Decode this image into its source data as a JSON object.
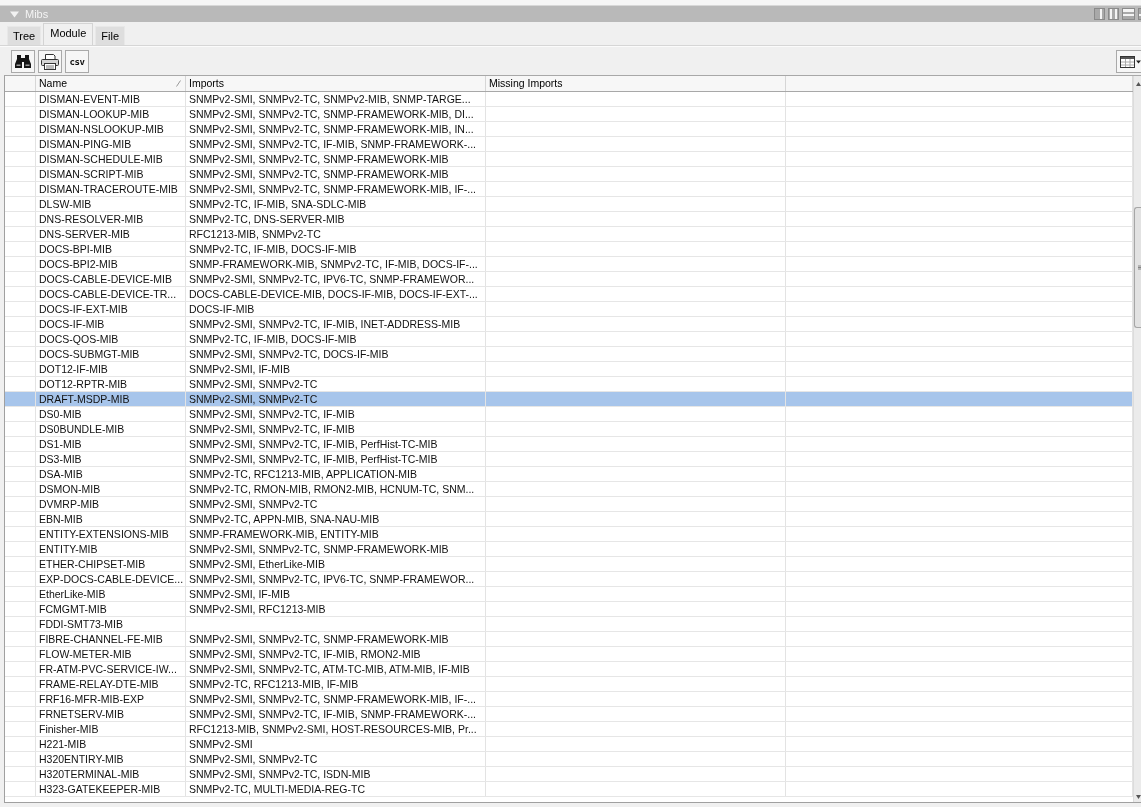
{
  "panel": {
    "title": "Mibs",
    "expanded": true
  },
  "tabs": [
    {
      "label": "Tree",
      "selected": false
    },
    {
      "label": "Module",
      "selected": true
    },
    {
      "label": "File",
      "selected": false
    }
  ],
  "toolbar": [
    {
      "kind": "find"
    },
    {
      "kind": "print"
    },
    {
      "kind": "csv",
      "label": "csv"
    }
  ],
  "table": {
    "columns": [
      {
        "label": "Name",
        "sorted": true
      },
      {
        "label": "Imports",
        "sorted": false
      },
      {
        "label": "Missing Imports",
        "sorted": false
      }
    ],
    "rows": [
      {
        "name": "DISMAN-EVENT-MIB",
        "imports": "SNMPv2-SMI, SNMPv2-TC, SNMPv2-MIB, SNMP-TARGE...",
        "selected": false
      },
      {
        "name": "DISMAN-LOOKUP-MIB",
        "imports": "SNMPv2-SMI, SNMPv2-TC, SNMP-FRAMEWORK-MIB, DI...",
        "selected": false
      },
      {
        "name": "DISMAN-NSLOOKUP-MIB",
        "imports": "SNMPv2-SMI, SNMPv2-TC, SNMP-FRAMEWORK-MIB, IN...",
        "selected": false
      },
      {
        "name": "DISMAN-PING-MIB",
        "imports": "SNMPv2-SMI, SNMPv2-TC, IF-MIB, SNMP-FRAMEWORK-...",
        "selected": false
      },
      {
        "name": "DISMAN-SCHEDULE-MIB",
        "imports": "SNMPv2-SMI, SNMPv2-TC, SNMP-FRAMEWORK-MIB",
        "selected": false
      },
      {
        "name": "DISMAN-SCRIPT-MIB",
        "imports": "SNMPv2-SMI, SNMPv2-TC, SNMP-FRAMEWORK-MIB",
        "selected": false
      },
      {
        "name": "DISMAN-TRACEROUTE-MIB",
        "imports": "SNMPv2-SMI, SNMPv2-TC, SNMP-FRAMEWORK-MIB, IF-...",
        "selected": false
      },
      {
        "name": "DLSW-MIB",
        "imports": "SNMPv2-TC, IF-MIB, SNA-SDLC-MIB",
        "selected": false
      },
      {
        "name": "DNS-RESOLVER-MIB",
        "imports": "SNMPv2-TC, DNS-SERVER-MIB",
        "selected": false
      },
      {
        "name": "DNS-SERVER-MIB",
        "imports": "RFC1213-MIB, SNMPv2-TC",
        "selected": false
      },
      {
        "name": "DOCS-BPI-MIB",
        "imports": "SNMPv2-TC, IF-MIB, DOCS-IF-MIB",
        "selected": false
      },
      {
        "name": "DOCS-BPI2-MIB",
        "imports": "SNMP-FRAMEWORK-MIB, SNMPv2-TC, IF-MIB, DOCS-IF-...",
        "selected": false
      },
      {
        "name": "DOCS-CABLE-DEVICE-MIB",
        "imports": "SNMPv2-SMI, SNMPv2-TC, IPV6-TC, SNMP-FRAMEWOR...",
        "selected": false
      },
      {
        "name": "DOCS-CABLE-DEVICE-TR...",
        "imports": "DOCS-CABLE-DEVICE-MIB, DOCS-IF-MIB, DOCS-IF-EXT-...",
        "selected": false
      },
      {
        "name": "DOCS-IF-EXT-MIB",
        "imports": "DOCS-IF-MIB",
        "selected": false
      },
      {
        "name": "DOCS-IF-MIB",
        "imports": "SNMPv2-SMI, SNMPv2-TC, IF-MIB, INET-ADDRESS-MIB",
        "selected": false
      },
      {
        "name": "DOCS-QOS-MIB",
        "imports": "SNMPv2-TC, IF-MIB, DOCS-IF-MIB",
        "selected": false
      },
      {
        "name": "DOCS-SUBMGT-MIB",
        "imports": "SNMPv2-SMI, SNMPv2-TC, DOCS-IF-MIB",
        "selected": false
      },
      {
        "name": "DOT12-IF-MIB",
        "imports": "SNMPv2-SMI, IF-MIB",
        "selected": false
      },
      {
        "name": "DOT12-RPTR-MIB",
        "imports": "SNMPv2-SMI, SNMPv2-TC",
        "selected": false
      },
      {
        "name": "DRAFT-MSDP-MIB",
        "imports": "SNMPv2-SMI, SNMPv2-TC",
        "selected": true
      },
      {
        "name": "DS0-MIB",
        "imports": "SNMPv2-SMI, SNMPv2-TC, IF-MIB",
        "selected": false
      },
      {
        "name": "DS0BUNDLE-MIB",
        "imports": "SNMPv2-SMI, SNMPv2-TC, IF-MIB",
        "selected": false
      },
      {
        "name": "DS1-MIB",
        "imports": "SNMPv2-SMI, SNMPv2-TC, IF-MIB, PerfHist-TC-MIB",
        "selected": false
      },
      {
        "name": "DS3-MIB",
        "imports": "SNMPv2-SMI, SNMPv2-TC, IF-MIB, PerfHist-TC-MIB",
        "selected": false
      },
      {
        "name": "DSA-MIB",
        "imports": "SNMPv2-TC, RFC1213-MIB, APPLICATION-MIB",
        "selected": false
      },
      {
        "name": "DSMON-MIB",
        "imports": "SNMPv2-TC, RMON-MIB, RMON2-MIB, HCNUM-TC, SNM...",
        "selected": false
      },
      {
        "name": "DVMRP-MIB",
        "imports": "SNMPv2-SMI, SNMPv2-TC",
        "selected": false
      },
      {
        "name": "EBN-MIB",
        "imports": "SNMPv2-TC, APPN-MIB, SNA-NAU-MIB",
        "selected": false
      },
      {
        "name": "ENTITY-EXTENSIONS-MIB",
        "imports": "SNMP-FRAMEWORK-MIB, ENTITY-MIB",
        "selected": false
      },
      {
        "name": "ENTITY-MIB",
        "imports": "SNMPv2-SMI, SNMPv2-TC, SNMP-FRAMEWORK-MIB",
        "selected": false
      },
      {
        "name": "ETHER-CHIPSET-MIB",
        "imports": "SNMPv2-SMI, EtherLike-MIB",
        "selected": false
      },
      {
        "name": "EXP-DOCS-CABLE-DEVICE...",
        "imports": "SNMPv2-SMI, SNMPv2-TC, IPV6-TC, SNMP-FRAMEWOR...",
        "selected": false
      },
      {
        "name": "EtherLike-MIB",
        "imports": "SNMPv2-SMI, IF-MIB",
        "selected": false
      },
      {
        "name": "FCMGMT-MIB",
        "imports": "SNMPv2-SMI, RFC1213-MIB",
        "selected": false
      },
      {
        "name": "FDDI-SMT73-MIB",
        "selected": false
      },
      {
        "name": "FIBRE-CHANNEL-FE-MIB",
        "imports": "SNMPv2-SMI, SNMPv2-TC, SNMP-FRAMEWORK-MIB",
        "selected": false
      },
      {
        "name": "FLOW-METER-MIB",
        "imports": "SNMPv2-SMI, SNMPv2-TC, IF-MIB, RMON2-MIB",
        "selected": false
      },
      {
        "name": "FR-ATM-PVC-SERVICE-IW...",
        "imports": "SNMPv2-SMI, SNMPv2-TC, ATM-TC-MIB, ATM-MIB, IF-MIB",
        "selected": false
      },
      {
        "name": "FRAME-RELAY-DTE-MIB",
        "imports": "SNMPv2-TC, RFC1213-MIB, IF-MIB",
        "selected": false
      },
      {
        "name": "FRF16-MFR-MIB-EXP",
        "imports": "SNMPv2-SMI, SNMPv2-TC, SNMP-FRAMEWORK-MIB, IF-...",
        "selected": false
      },
      {
        "name": "FRNETSERV-MIB",
        "imports": "SNMPv2-SMI, SNMPv2-TC, IF-MIB, SNMP-FRAMEWORK-...",
        "selected": false
      },
      {
        "name": "Finisher-MIB",
        "imports": "RFC1213-MIB, SNMPv2-SMI, HOST-RESOURCES-MIB, Pr...",
        "selected": false
      },
      {
        "name": "H221-MIB",
        "imports": "SNMPv2-SMI",
        "selected": false
      },
      {
        "name": "H320ENTIRY-MIB",
        "imports": "SNMPv2-SMI, SNMPv2-TC",
        "selected": false
      },
      {
        "name": "H320TERMINAL-MIB",
        "imports": "SNMPv2-SMI, SNMPv2-TC, ISDN-MIB",
        "selected": false
      },
      {
        "name": "H323-GATEKEEPER-MIB",
        "imports": "SNMPv2-TC, MULTI-MEDIA-REG-TC",
        "selected": false
      }
    ]
  }
}
